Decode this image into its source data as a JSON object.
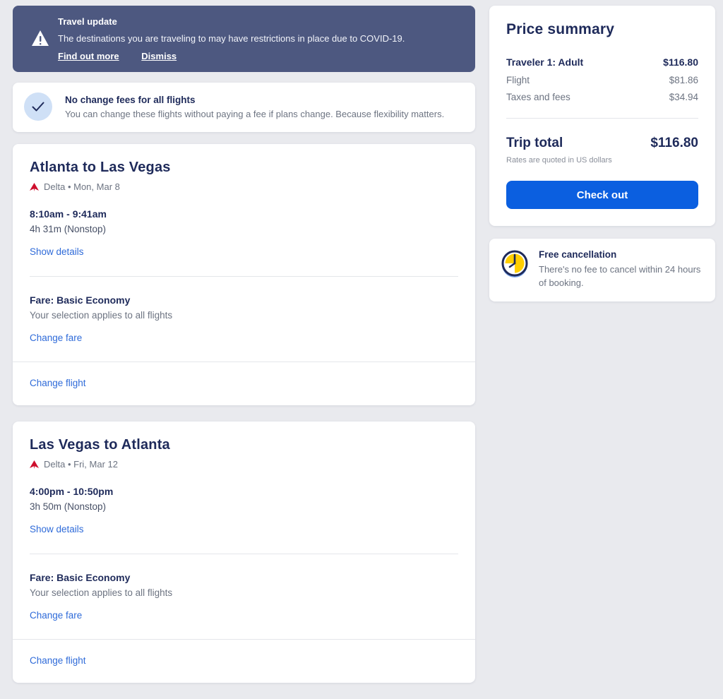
{
  "colors": {
    "page_bg": "#e9eaee",
    "banner_bg": "#4d5880",
    "navy_text": "#1e2a5a",
    "gray_text": "#6d7482",
    "link_blue": "#2f6bd9",
    "checkout_button": "#0b5fe0",
    "delta_red": "#ce0e2d",
    "clock_yellow": "#ffce00",
    "check_circle_bg": "#cfe0f6"
  },
  "travel_banner": {
    "title": "Travel update",
    "message": "The destinations you are traveling to may have restrictions in place due to COVID-19.",
    "find_out_more": "Find out more",
    "dismiss": "Dismiss"
  },
  "no_change_fees": {
    "title": "No change fees for all flights",
    "subtitle": "You can change these flights without paying a fee if plans change. Because flexibility matters."
  },
  "flights": [
    {
      "title": "Atlanta to Las Vegas",
      "airline_date": "Delta • Mon, Mar 8",
      "times": "8:10am - 9:41am",
      "duration": "4h 31m (Nonstop)",
      "show_details": "Show details",
      "fare": "Fare: Basic Economy",
      "fare_note": "Your selection applies to all flights",
      "change_fare": "Change fare",
      "change_flight": "Change flight"
    },
    {
      "title": "Las Vegas to Atlanta",
      "airline_date": "Delta • Fri, Mar 12",
      "times": "4:00pm - 10:50pm",
      "duration": "3h 50m (Nonstop)",
      "show_details": "Show details",
      "fare": "Fare: Basic Economy",
      "fare_note": "Your selection applies to all flights",
      "change_fare": "Change fare",
      "change_flight": "Change flight"
    }
  ],
  "price_summary": {
    "title": "Price summary",
    "rows": [
      {
        "label": "Traveler 1: Adult",
        "value": "$116.80"
      },
      {
        "label": "Flight",
        "value": "$81.86"
      },
      {
        "label": "Taxes and fees",
        "value": "$34.94"
      }
    ],
    "trip_total_label": "Trip total",
    "trip_total_value": "$116.80",
    "rates_note": "Rates are quoted in US dollars",
    "checkout_label": "Check out"
  },
  "free_cancellation": {
    "title": "Free cancellation",
    "subtitle": "There's no fee to cancel within 24 hours of booking."
  }
}
